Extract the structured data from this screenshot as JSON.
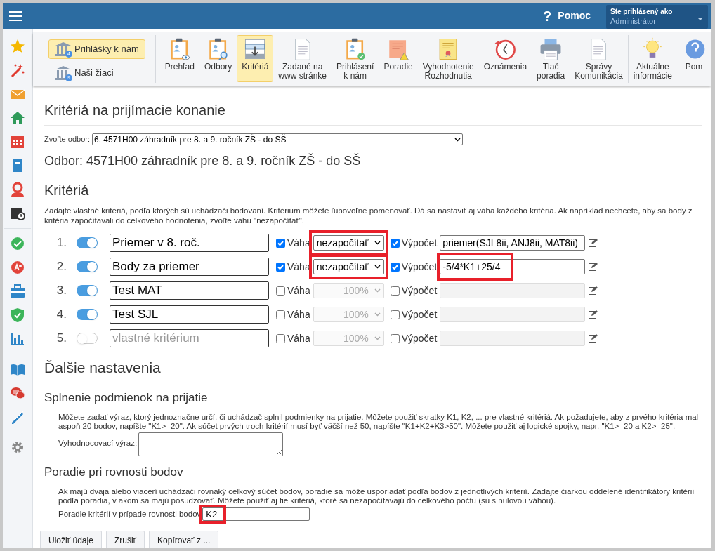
{
  "top_bar": {
    "help": "Pomoc",
    "help_glyph": "?",
    "user_caption": "Ste prihlásený ako",
    "user_name": "Administrátor"
  },
  "toolbar": {
    "side_items": [
      {
        "label": "Prihlášky k nám",
        "badge": "4",
        "selected": true
      },
      {
        "label": "Naši žiaci",
        "badge": "9",
        "selected": false
      }
    ],
    "items": [
      {
        "label": "Prehľad",
        "selected": false
      },
      {
        "label": "Odbory",
        "selected": false
      },
      {
        "label": "Kritériá",
        "selected": true
      },
      {
        "label": "Zadané na\nwww stránke",
        "selected": false
      },
      {
        "label": "Prihlásení\nk nám",
        "selected": false
      },
      {
        "label": "Poradie",
        "selected": false
      },
      {
        "label": "Vyhodnotenie\nRozhodnutia",
        "selected": false
      },
      {
        "label": "Oznámenia",
        "selected": false
      },
      {
        "label": "Tlač\nporadia",
        "selected": false
      },
      {
        "label": "Správy\nKomunikácia",
        "selected": false
      }
    ],
    "extra_items": [
      {
        "label": "Aktuálne\ninformácie",
        "selected": false
      },
      {
        "label": "Pom",
        "selected": false
      }
    ]
  },
  "page_title": "Kritériá na prijímacie konanie",
  "field_select": {
    "label": "Zvoľte odbor:",
    "value": "6. 4571H00 záhradník pre 8. a 9. ročník ZŠ - do SŠ"
  },
  "field_heading": "Odbor: 4571H00 záhradník pre 8. a 9. ročník ZŠ - do SŠ",
  "criteria_heading": "Kritériá",
  "criteria_help": "Zadajte vlastné kritériá, podľa ktorých sú uchádzači bodovaní. Kritérium môžete ľubovoľne pomenovať. Dá sa nastaviť aj váha každého kritéria. Ak napríklad nechcete, aby sa body z kritéria započítavali do celkového hodnotenia, zvoľte váhu \"nezapočítať\".",
  "criteria": [
    {
      "number": "1.",
      "on": true,
      "name": "Priemer v 8. roč.",
      "weight_checked": true,
      "weight_label": "Váha",
      "weight": "nezapočítať",
      "weight_marked": true,
      "formula_checked": true,
      "formula_label": "Výpočet",
      "formula": "priemer(SJL8ii, ANJ8ii, MAT8ii)",
      "formula_marked": false
    },
    {
      "number": "2.",
      "on": true,
      "name": "Body za priemer",
      "weight_checked": true,
      "weight_label": "Váha",
      "weight": "nezapočítať",
      "weight_marked": true,
      "formula_checked": true,
      "formula_label": "Výpočet",
      "formula": "-5/4*K1+25/4",
      "formula_marked": true
    },
    {
      "number": "3.",
      "on": true,
      "name": "Test MAT",
      "weight_checked": false,
      "weight_label": "Váha",
      "weight": "100%",
      "weight_marked": false,
      "formula_checked": false,
      "formula_label": "Výpočet",
      "formula_marked": false
    },
    {
      "number": "4.",
      "on": true,
      "name": "Test SJL",
      "weight_checked": false,
      "weight_label": "Váha",
      "weight": "100%",
      "weight_marked": false,
      "formula_checked": false,
      "formula_label": "Výpočet",
      "formula_marked": false
    },
    {
      "number": "5.",
      "on": false,
      "placeholder": "vlastné kritérium",
      "weight_checked": false,
      "weight_label": "Váha",
      "weight": "100%",
      "weight_marked": false,
      "formula_checked": false,
      "formula_label": "Výpočet",
      "formula_marked": false
    }
  ],
  "more_heading": "Ďalšie nastavenia",
  "conditions": {
    "heading": "Splnenie podmienok na prijatie",
    "help": "Môžete zadať výraz, ktorý jednoznačne určí, či uchádzač splnil podmienky na prijatie. Môžete použiť skratky K1, K2, ... pre vlastné kritériá. Ak požadujete, aby z prvého kritéria mal aspoň 20 bodov, napíšte \"K1>=20\". Ak súčet prvých troch kritérií musí byť väčší než 50, napíšte \"K1+K2+K3>50\". Môžete použiť aj logické spojky, napr. \"K1>=20 a K2>=25\".",
    "field_label": "Vyhodnocovací výraz:"
  },
  "tie": {
    "heading": "Poradie pri rovnosti bodov",
    "help": "Ak majú dvaja alebo viacerí uchádzači rovnaký celkový súčet bodov, poradie sa môže usporiadať podľa bodov z jednotlivých kritérií. Zadajte čiarkou oddelené identifikátory kritérií podľa poradia, v akom sa majú posudzovať. Môžete použiť aj tie kritériá, ktoré sa nezapočítavajú do celkového počtu (sú s nulovou váhou).",
    "field_label": "Poradie kritérií v prípade rovnosti bodov",
    "value": "K2",
    "marked": true
  },
  "buttons": [
    "Uložiť údaje",
    "Zrušiť",
    "Kopírovať z ..."
  ]
}
